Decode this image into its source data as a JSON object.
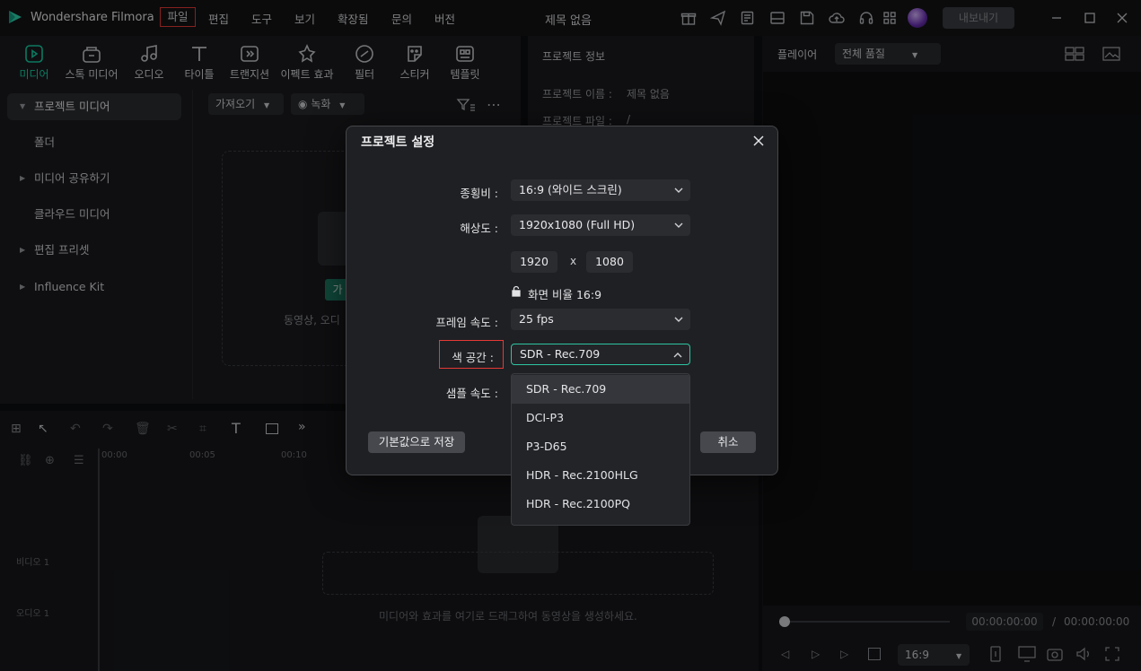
{
  "titlebar": {
    "app_name": "Wondershare Filmora",
    "menus": [
      "파일",
      "편집",
      "도구",
      "보기",
      "확장됨",
      "문의",
      "버전"
    ],
    "document_title": "제목 없음",
    "export_label": "내보내기"
  },
  "toolbar": {
    "items": [
      {
        "label": "미디어",
        "icon": "media-icon"
      },
      {
        "label": "스톡 미디어",
        "icon": "stock-media-icon"
      },
      {
        "label": "오디오",
        "icon": "audio-icon"
      },
      {
        "label": "타이틀",
        "icon": "title-icon"
      },
      {
        "label": "트랜지션",
        "icon": "transition-icon"
      },
      {
        "label": "이펙트 효과",
        "icon": "effects-icon"
      },
      {
        "label": "필터",
        "icon": "filter-icon"
      },
      {
        "label": "스티커",
        "icon": "sticker-icon"
      },
      {
        "label": "템플릿",
        "icon": "template-icon"
      }
    ]
  },
  "sidebar": {
    "items": [
      "프로젝트 미디어",
      "폴더",
      "미디어 공유하기",
      "클라우드 미디어",
      "편집 프리셋",
      "Influence Kit"
    ]
  },
  "media": {
    "import_label": "가져오기",
    "record_label": "녹화",
    "import_button_fragment": "가",
    "drop_hint_fragment": "동영상, 오디"
  },
  "info_panel": {
    "title": "프로젝트 정보",
    "name_label": "프로젝트 이름 :",
    "name_value": "제목 없음",
    "folder_label": "프로젝트 파일 :",
    "folder_value": "/"
  },
  "player": {
    "label": "플레이어",
    "quality": "전체 품질",
    "time_current": "00:00:00:00",
    "time_separator": "/",
    "time_total": "00:00:00:00",
    "ratio": "16:9"
  },
  "timeline": {
    "ruler": [
      "00:00",
      "00:05",
      "00:10"
    ],
    "track_video": "비디오 1",
    "track_audio": "오디오 1",
    "drop_hint": "미디어와 효과를 여기로 드래그하여 동영상을 생성하세요."
  },
  "dialog": {
    "title": "프로젝트 설정",
    "aspect_label": "종횡비 :",
    "aspect_value": "16:9 (와이드 스크린)",
    "resolution_label": "해상도 :",
    "resolution_value": "1920x1080 (Full HD)",
    "width": "1920",
    "x_sep": "x",
    "height": "1080",
    "lock_ratio": "화면 비율 16:9",
    "framerate_label": "프레임 속도 :",
    "framerate_value": "25 fps",
    "colorspace_label": "색 공간 :",
    "colorspace_value": "SDR - Rec.709",
    "samplerate_label": "샘플 속도 :",
    "save_default_label": "기본값으로 저장",
    "cancel_label": "취소",
    "colorspace_options": [
      "SDR - Rec.709",
      "DCI-P3",
      "P3-D65",
      "HDR - Rec.2100HLG",
      "HDR - Rec.2100PQ"
    ]
  },
  "colors": {
    "accent": "#16d1a6",
    "highlight_box": "#e53935"
  }
}
